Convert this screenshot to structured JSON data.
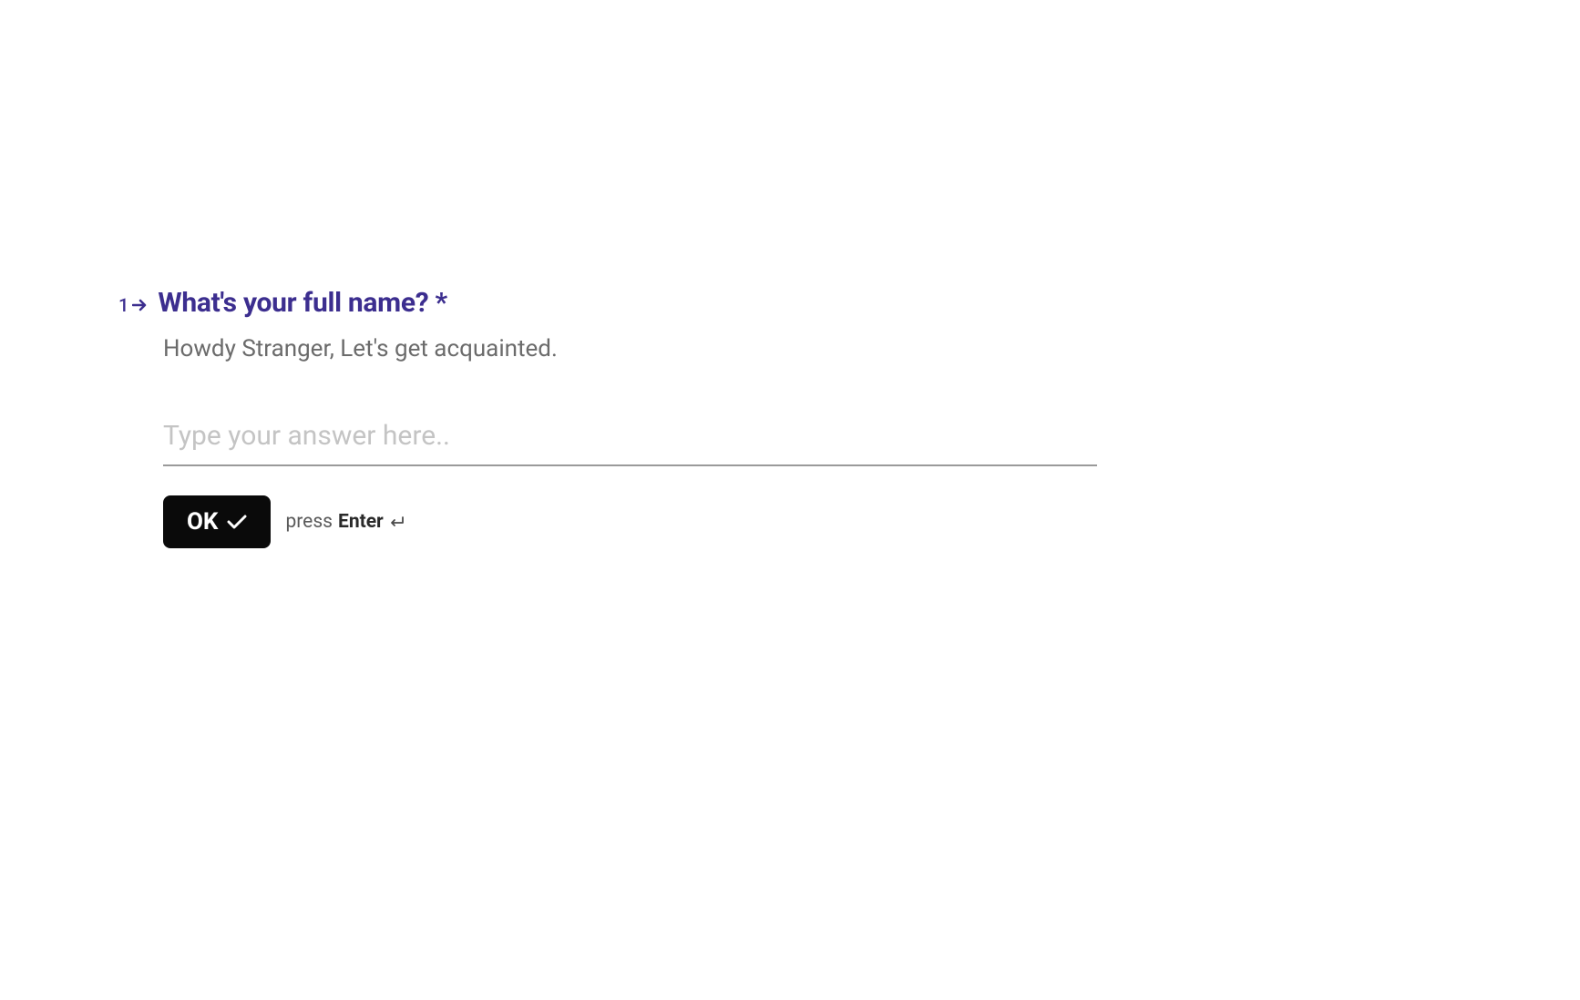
{
  "question": {
    "number": "1",
    "title": "What's your full name? *",
    "subtitle": "Howdy Stranger, Let's get acquainted."
  },
  "input": {
    "placeholder": "Type your answer here..",
    "value": ""
  },
  "actions": {
    "ok_label": "OK",
    "hint_prefix": "press",
    "hint_key": "Enter"
  }
}
